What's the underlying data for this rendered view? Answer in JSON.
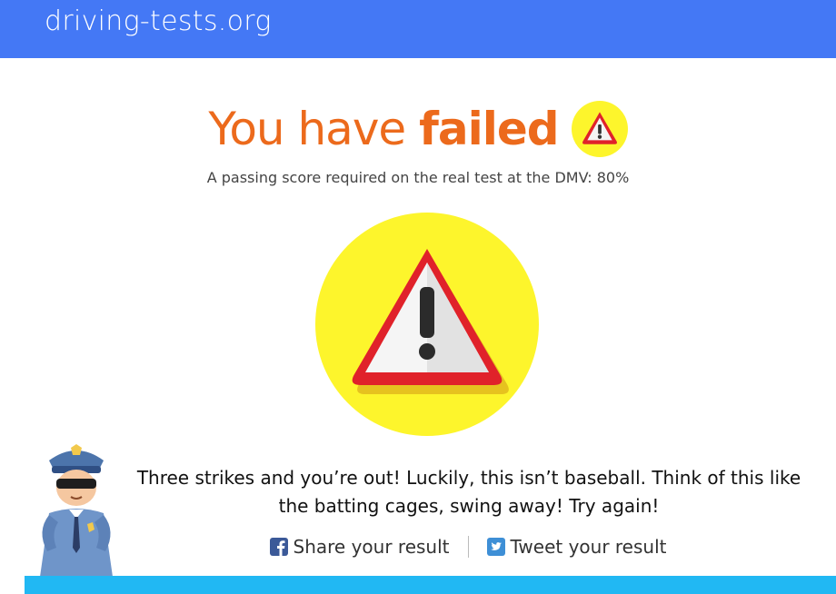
{
  "header": {
    "logo_text": "driving-tests.org",
    "background_color": "#4478f5"
  },
  "result": {
    "title_prefix": "You have ",
    "title_emphasis": "failed",
    "title_color": "#ec6a1c",
    "subtitle": "A passing score required on the real test at the DMV: 80%",
    "icon": "warning-triangle-icon",
    "message": "Three strikes and you’re out! Luckily, this isn’t baseball. Think of this like the batting cages, swing away! Try again!"
  },
  "share": {
    "facebook_label": "Share your result",
    "facebook_icon": "facebook-icon",
    "twitter_label": "Tweet your result",
    "twitter_icon": "twitter-icon"
  },
  "colors": {
    "warning_yellow": "#fdf52c",
    "warning_red": "#e0222a",
    "bottom_bar": "#21b8f3"
  }
}
